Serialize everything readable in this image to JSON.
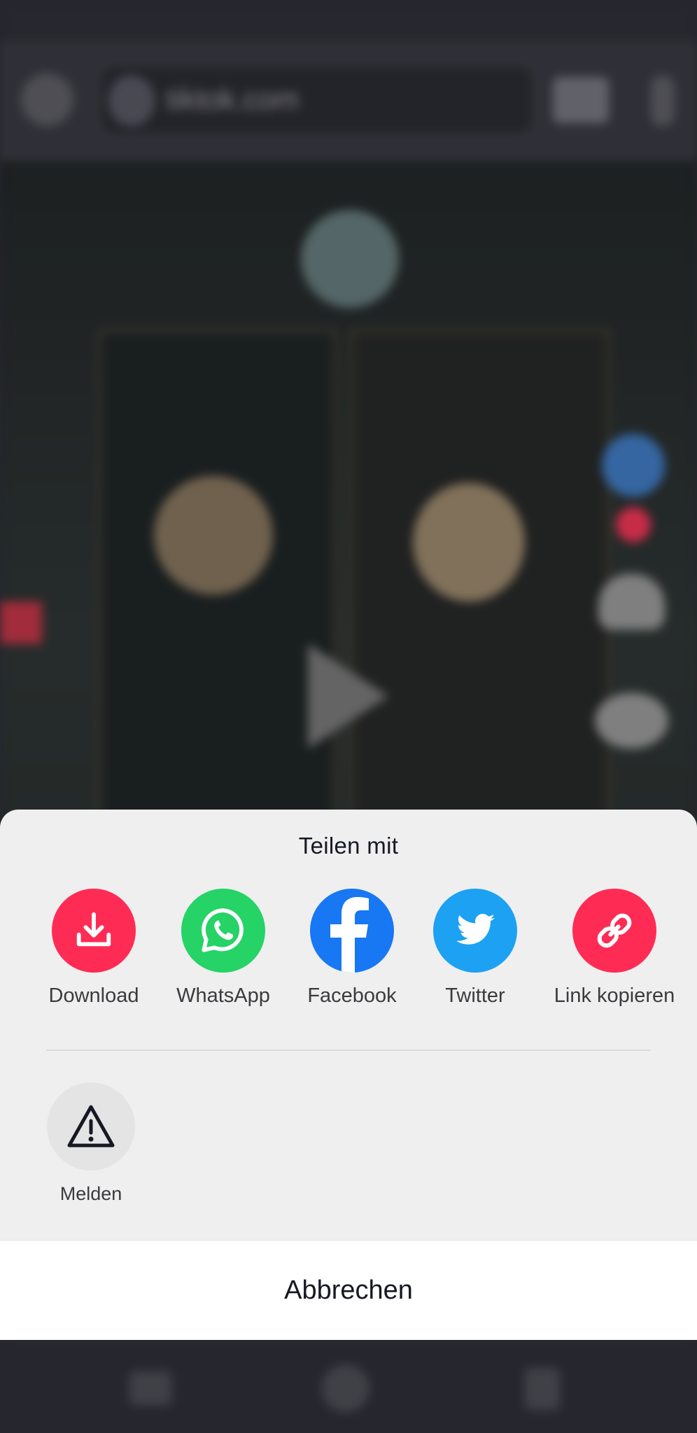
{
  "background": {
    "url": "tiktok.com"
  },
  "share_sheet": {
    "title": "Teilen mit",
    "items": [
      {
        "label": "Download",
        "icon": "download-icon",
        "color": "#FE2C55"
      },
      {
        "label": "WhatsApp",
        "icon": "whatsapp-icon",
        "color": "#25D366"
      },
      {
        "label": "Facebook",
        "icon": "facebook-icon",
        "color": "#1877F2"
      },
      {
        "label": "Twitter",
        "icon": "twitter-icon",
        "color": "#1DA1F2"
      },
      {
        "label": "Link kopieren",
        "icon": "link-icon",
        "color": "#FE2C55"
      }
    ],
    "actions": [
      {
        "label": "Melden",
        "icon": "warning-icon"
      }
    ],
    "cancel_label": "Abbrechen"
  }
}
